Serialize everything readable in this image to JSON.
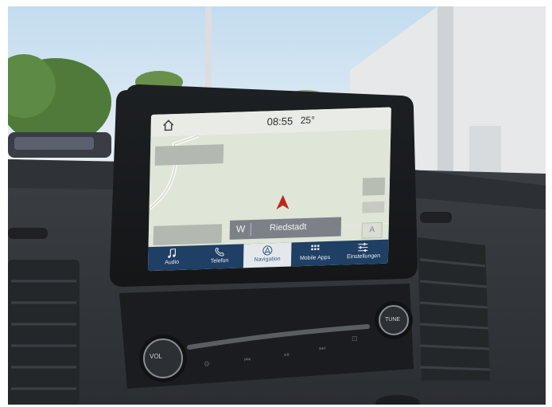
{
  "status_bar": {
    "time": "08:55",
    "temperature": "25°"
  },
  "map": {
    "street_direction": "W",
    "street_name": "Riedstadt",
    "compass_label": "A"
  },
  "tabs": [
    {
      "label": "Audio",
      "icon": "music-note-icon",
      "active": false
    },
    {
      "label": "Telefon",
      "icon": "phone-icon",
      "active": false
    },
    {
      "label": "Navigation",
      "icon": "navigation-icon",
      "active": true
    },
    {
      "label": "Mobile Apps",
      "icon": "apps-grid-icon",
      "active": false
    },
    {
      "label": "Einstellungen",
      "icon": "settings-sliders-icon",
      "active": false
    }
  ],
  "knobs": {
    "volume_label": "VOL",
    "tune_label": "TUNE"
  },
  "colors": {
    "tab_bar": "#1f3f64",
    "active_tab": "#e4e8ea",
    "nav_arrow": "#c0261d",
    "street_bar": "#7c8188"
  }
}
